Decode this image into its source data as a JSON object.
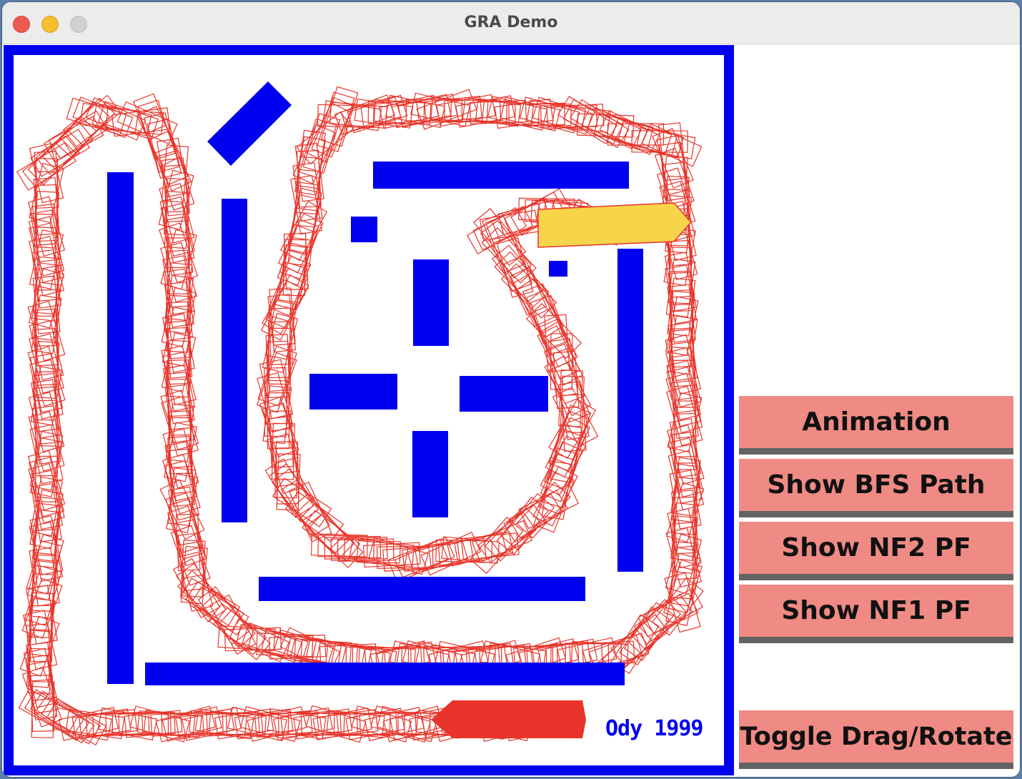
{
  "window": {
    "title": "GRA Demo"
  },
  "workspace": {
    "robot_color": "#e8342a",
    "goal_color": "#f7d44a",
    "obstacle_color": "#0000f0",
    "signature": "Ody 1999"
  },
  "buttons": {
    "animation": "Animation",
    "show_bfs_path": "Show BFS Path",
    "show_nf2_pf": "Show NF2 PF",
    "show_nf1_pf": "Show NF1 PF",
    "toggle_drag_rotate": "Toggle Drag/Rotate"
  }
}
